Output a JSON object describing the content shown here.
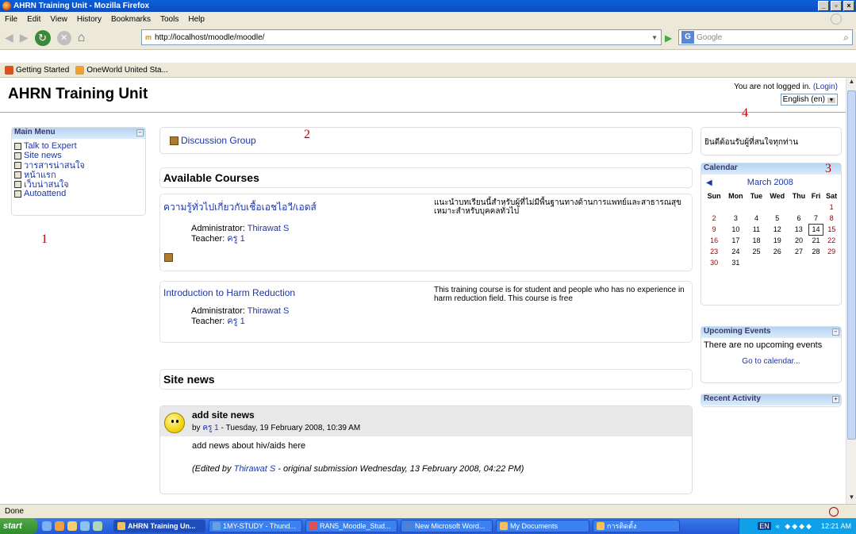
{
  "window": {
    "title": "AHRN Training Unit - Mozilla Firefox"
  },
  "menu": [
    "File",
    "Edit",
    "View",
    "History",
    "Bookmarks",
    "Tools",
    "Help"
  ],
  "nav": {
    "url": "http://localhost/moodle/moodle/",
    "search_placeholder": "Google"
  },
  "bookmarks": [
    {
      "label": "Getting Started",
      "color": "#d9531e"
    },
    {
      "label": "OneWorld United Sta...",
      "color": "#f0a030"
    }
  ],
  "page": {
    "site_title": "AHRN Training Unit",
    "login_text": "You are not logged in.",
    "login_link": "(Login)",
    "language": "English (en)"
  },
  "main_menu": {
    "title": "Main Menu",
    "items": [
      "Talk to Expert",
      "Site news",
      "วารสารน่าสนใจ",
      "หน้าแรก",
      "เว็บน่าสนใจ",
      "Autoattend"
    ]
  },
  "discussion": {
    "label": "Discussion Group"
  },
  "available_courses": {
    "heading": "Available Courses",
    "courses": [
      {
        "name": "ความรู้ทั่วไปเกี่ยวกับเชื้อเอชไอวี/เอดส์",
        "admin_label": "Administrator:",
        "admin": "Thirawat S",
        "teacher_label": "Teacher:",
        "teacher": "ครู 1",
        "summary": "แนะนำบทเรียนนี้สำหรับผู้ที่ไม่มีพื้นฐานทางด้านการแพทย์และสาธารณสุข เหมาะสำหรับบุคคลทั่วไป"
      },
      {
        "name": "Introduction to Harm Reduction",
        "admin_label": "Administrator:",
        "admin": "Thirawat S",
        "teacher_label": "Teacher:",
        "teacher": "ครู 1",
        "summary": "This training course is for student and people who has no experience in harm reduction field. This course is free"
      }
    ]
  },
  "site_news": {
    "heading": "Site news",
    "post": {
      "title": "add site news",
      "by_prefix": "by",
      "author": "ครู 1",
      "date": "- Tuesday, 19 February 2008, 10:39 AM",
      "body": "add news about hiv/aids here",
      "edit_open": "(Edited by",
      "editor": "Thirawat S",
      "edit_rest": "- original submission Wednesday, 13 February 2008, 04:22 PM)"
    }
  },
  "welcome": {
    "text": "ยินดีต้อนรับผู้ที่สนใจทุกท่าน"
  },
  "calendar": {
    "title": "Calendar",
    "month": "March 2008",
    "days": [
      "Sun",
      "Mon",
      "Tue",
      "Wed",
      "Thu",
      "Fri",
      "Sat"
    ],
    "weeks": [
      [
        "",
        "",
        "",
        "",
        "",
        "",
        "1"
      ],
      [
        "2",
        "3",
        "4",
        "5",
        "6",
        "7",
        "8"
      ],
      [
        "9",
        "10",
        "11",
        "12",
        "13",
        "14",
        "15"
      ],
      [
        "16",
        "17",
        "18",
        "19",
        "20",
        "21",
        "22"
      ],
      [
        "23",
        "24",
        "25",
        "26",
        "27",
        "28",
        "29"
      ],
      [
        "30",
        "31",
        "",
        "",
        "",
        "",
        ""
      ]
    ],
    "today": "14"
  },
  "upcoming": {
    "title": "Upcoming Events",
    "text": "There are no upcoming events",
    "link": "Go to calendar..."
  },
  "recent": {
    "title": "Recent Activity"
  },
  "annotations": [
    "1",
    "2",
    "3",
    "4"
  ],
  "status": {
    "text": "Done"
  },
  "taskbar": {
    "start": "start",
    "tasks": [
      "AHRN Training Un...",
      "1MY-STUDY - Thund...",
      "RAN5_Moodle_Stud...",
      "New Microsoft Word...",
      "My Documents",
      "การติดตั้ง"
    ],
    "lang": "EN",
    "time": "12:21 AM"
  }
}
